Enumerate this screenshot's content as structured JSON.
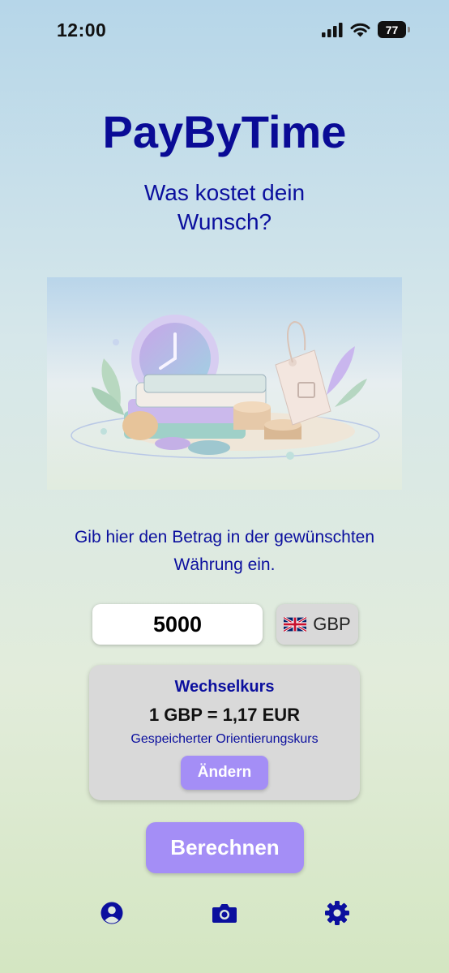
{
  "status_bar": {
    "time": "12:00",
    "battery": "77"
  },
  "app": {
    "title": "PayByTime",
    "subtitle": "Was kostet dein Wunsch?"
  },
  "hero_image": {
    "icon": "money-clock-price-tag-illustration"
  },
  "form": {
    "instruction": "Gib hier den Betrag in der gewünschten Währung ein.",
    "amount_value": "5000",
    "currency": {
      "flag": "🇬🇧",
      "code": "GBP"
    }
  },
  "exchange_rate": {
    "heading": "Wechselkurs",
    "value": "1 GBP = 1,17 EUR",
    "note": "Gespeicherter Orientierungskurs",
    "change_label": "Ändern"
  },
  "actions": {
    "calculate_label": "Berechnen"
  },
  "tab_bar": {
    "items": [
      {
        "icon": "profile-icon"
      },
      {
        "icon": "camera-icon"
      },
      {
        "icon": "settings-icon"
      }
    ]
  },
  "colors": {
    "primary_text": "#0b0f9e",
    "accent_button": "#a48ef6",
    "card_bg": "#d9d9d9"
  }
}
